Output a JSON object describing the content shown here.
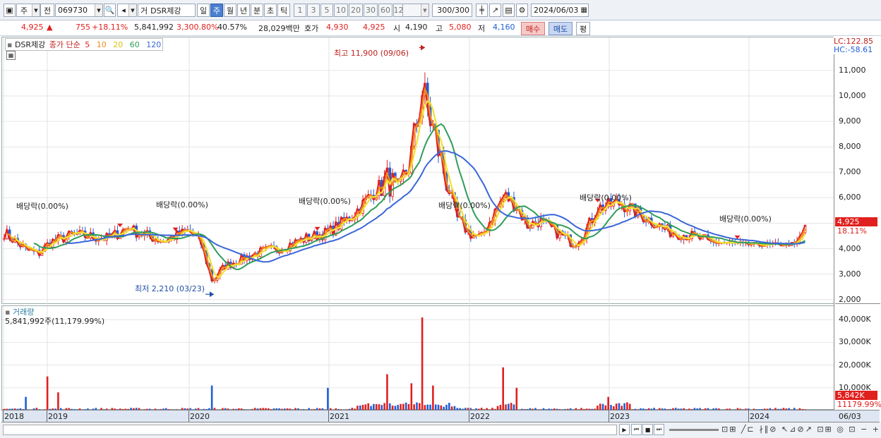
{
  "toolbar": {
    "type": "주",
    "prev": "전",
    "code": "069730",
    "market": "거",
    "name": "DSR제강",
    "periods": [
      "일",
      "주",
      "월",
      "년",
      "분",
      "초",
      "틱"
    ],
    "selected_period": "주",
    "intervals": [
      "1",
      "3",
      "5",
      "10",
      "20",
      "30",
      "60",
      "120"
    ],
    "count": "300",
    "count_total": "/300",
    "date": "2024/06/03"
  },
  "quote": {
    "price": "4,925",
    "change_arrow": "▲",
    "change": "755",
    "change_pct": "+18.11%",
    "volume": "5,841,992",
    "volume_pct": "3,300.80%",
    "turnover": "40.57%",
    "amount": "28,029백만",
    "bid_label": "호가",
    "ask": "4,930",
    "bid": "4,925",
    "open_label": "시",
    "open": "4,190",
    "high_label": "고",
    "high": "5,080",
    "low_label": "저",
    "low": "4,160",
    "buy_label": "매수",
    "sell_label": "매도",
    "eval_label": "평"
  },
  "price_pane": {
    "stock_label": "DSR제강",
    "legend": {
      "main": "종가 단순",
      "ma5": "5",
      "ma10": "10",
      "ma20": "20",
      "ma60": "60",
      "ma120": "120"
    },
    "annotations": {
      "high": "최고 11,900 (09/06)",
      "low": "최저 2,210 (03/23)",
      "dividend": "배당락(0.00%)"
    },
    "lc": "LC:122.85",
    "hc": "HC:-58.61",
    "current_price": "4,925",
    "current_pct": "18.11%"
  },
  "volume_pane": {
    "label": "거래량",
    "value": "5,841,992주(11,179.99%)",
    "current": "5,842K",
    "current_pct": "11179.99%"
  },
  "axes": {
    "price_ticks": [
      "11,000",
      "10,000",
      "9,000",
      "8,000",
      "7,000",
      "6,000",
      "5,000",
      "4,000",
      "3,000",
      "2,000"
    ],
    "volume_ticks": [
      "40,000K",
      "30,000K",
      "20,000K",
      "10,000K"
    ],
    "years": [
      "2018",
      "2019",
      "2020",
      "2021",
      "2022",
      "2023",
      "2024"
    ],
    "end_label": "06/03"
  },
  "chart_data": {
    "type": "candlestick",
    "ylim": [
      1800,
      12300
    ],
    "volume_ylim_k": [
      0,
      46000
    ],
    "years": [
      "2018",
      "2019",
      "2020",
      "2021",
      "2022",
      "2023",
      "2024"
    ],
    "close_path": [
      [
        "2018-01",
        4650
      ],
      [
        "2018-02",
        4300
      ],
      [
        "2018-03",
        3950
      ],
      [
        "2018-04",
        3800
      ],
      [
        "2018-05",
        4250
      ],
      [
        "2018-07",
        4550
      ],
      [
        "2018-10",
        4400
      ],
      [
        "2018-12",
        4900
      ],
      [
        "2019-01",
        5100
      ],
      [
        "2019-02",
        5500
      ],
      [
        "2019-03",
        5200
      ],
      [
        "2019-05",
        5050
      ],
      [
        "2019-07",
        4950
      ],
      [
        "2019-09",
        4600
      ],
      [
        "2019-11",
        4300
      ],
      [
        "2019-12",
        4500
      ],
      [
        "2020-01",
        4700
      ],
      [
        "2020-02",
        4250
      ],
      [
        "2020-03",
        2700
      ],
      [
        "2020-04",
        3300
      ],
      [
        "2020-05",
        3500
      ],
      [
        "2020-07",
        3850
      ],
      [
        "2020-09",
        4050
      ],
      [
        "2020-11",
        4400
      ],
      [
        "2021-01",
        4650
      ],
      [
        "2021-03",
        5300
      ],
      [
        "2021-05",
        6300
      ],
      [
        "2021-06",
        6700
      ],
      [
        "2021-07",
        6300
      ],
      [
        "2021-08",
        7500
      ],
      [
        "2021-09",
        10200
      ],
      [
        "2021-10",
        8600
      ],
      [
        "2021-11",
        6800
      ],
      [
        "2021-12",
        5200
      ],
      [
        "2022-01",
        4600
      ],
      [
        "2022-02",
        4400
      ],
      [
        "2022-03",
        5300
      ],
      [
        "2022-04",
        6100
      ],
      [
        "2022-05",
        5700
      ],
      [
        "2022-06",
        4900
      ],
      [
        "2022-07",
        5100
      ],
      [
        "2022-09",
        4500
      ],
      [
        "2022-10",
        4200
      ],
      [
        "2022-11",
        4700
      ],
      [
        "2022-12",
        5600
      ],
      [
        "2023-02",
        5800
      ],
      [
        "2023-03",
        5500
      ],
      [
        "2023-05",
        5000
      ],
      [
        "2023-06",
        4700
      ],
      [
        "2023-08",
        4500
      ],
      [
        "2023-10",
        4250
      ],
      [
        "2023-12",
        4200
      ],
      [
        "2024-02",
        4150
      ],
      [
        "2024-04",
        4170
      ],
      [
        "2024-05",
        4180
      ],
      [
        "2024-06",
        4925
      ]
    ],
    "high": {
      "value": 11900,
      "date": "09/06"
    },
    "low": {
      "value": 2210,
      "date": "03/23"
    },
    "volume_spikes_k": [
      [
        "2018-03",
        6000
      ],
      [
        "2019-01",
        15000
      ],
      [
        "2019-02",
        8000
      ],
      [
        "2020-03",
        11000
      ],
      [
        "2021-01",
        10000
      ],
      [
        "2021-06",
        16000
      ],
      [
        "2021-08",
        12000
      ],
      [
        "2021-09",
        41000
      ],
      [
        "2021-10",
        11000
      ],
      [
        "2022-04",
        19000
      ],
      [
        "2022-05",
        10000
      ],
      [
        "2023-01",
        6000
      ],
      [
        "2024-06",
        5842
      ]
    ],
    "series": [
      {
        "name": "5",
        "color": "#e02020"
      },
      {
        "name": "10",
        "color": "#f28c1c"
      },
      {
        "name": "20",
        "color": "#f2e030"
      },
      {
        "name": "60",
        "color": "#2e9c5a"
      },
      {
        "name": "120",
        "color": "#3a66d8"
      }
    ]
  },
  "colors": {
    "up": "#e0201e",
    "down": "#1f5fd6",
    "ma5": "#e02020",
    "ma10": "#f28c1c",
    "ma20": "#f2e030",
    "ma60": "#2e9c5a",
    "ma120": "#3a66d8"
  }
}
